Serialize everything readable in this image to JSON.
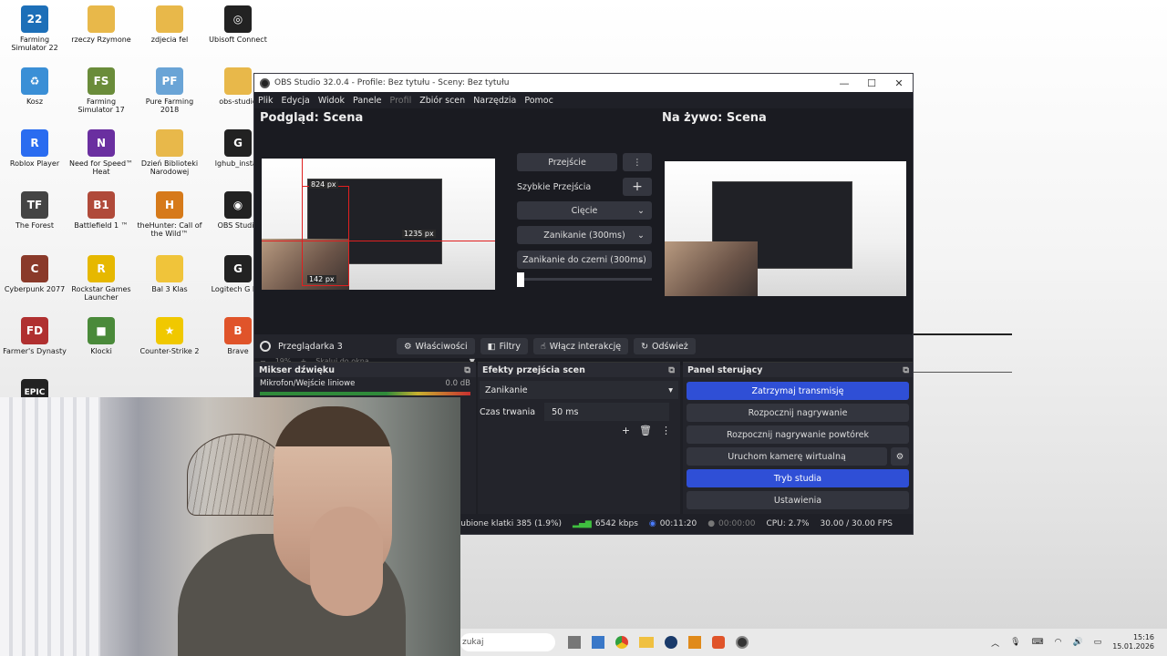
{
  "desktop": {
    "icons": [
      {
        "label": "Farming Simulator 22",
        "glyph": "22",
        "color": "#1d6fb8"
      },
      {
        "label": "rzeczy Rzymone",
        "glyph": "",
        "color": "#e8b84a"
      },
      {
        "label": "zdjecia fel",
        "glyph": "",
        "color": "#e8b84a"
      },
      {
        "label": "Ubisoft Connect",
        "glyph": "◎",
        "color": "#222"
      },
      {
        "label": "Kosz",
        "glyph": "♻",
        "color": "#3a8fd6"
      },
      {
        "label": "Farming Simulator 17",
        "glyph": "FS",
        "color": "#6a8c3a"
      },
      {
        "label": "Pure Farming 2018",
        "glyph": "PF",
        "color": "#6aa4d6"
      },
      {
        "label": "obs-studio",
        "glyph": "",
        "color": "#e8b84a"
      },
      {
        "label": "Roblox Player",
        "glyph": "R",
        "color": "#2a6cf0"
      },
      {
        "label": "Need for Speed™ Heat",
        "glyph": "N",
        "color": "#6a2fa0"
      },
      {
        "label": "Dzień Biblioteki Narodowej",
        "glyph": "",
        "color": "#e8b84a"
      },
      {
        "label": "lghub_install",
        "glyph": "G",
        "color": "#222"
      },
      {
        "label": "The Forest",
        "glyph": "TF",
        "color": "#444"
      },
      {
        "label": "Battlefield 1 ™",
        "glyph": "B1",
        "color": "#b04a3a"
      },
      {
        "label": "theHunter: Call of the Wild™",
        "glyph": "H",
        "color": "#d67a1a"
      },
      {
        "label": "OBS Studio",
        "glyph": "◉",
        "color": "#222"
      },
      {
        "label": "Cyberpunk 2077",
        "glyph": "C",
        "color": "#8a3a2a"
      },
      {
        "label": "Rockstar Games Launcher",
        "glyph": "R",
        "color": "#e6b800"
      },
      {
        "label": "Bal 3 Klas",
        "glyph": "",
        "color": "#f0c43a"
      },
      {
        "label": "Logitech G H...",
        "glyph": "G",
        "color": "#222"
      },
      {
        "label": "Farmer's Dynasty",
        "glyph": "FD",
        "color": "#b03030"
      },
      {
        "label": "Klocki",
        "glyph": "■",
        "color": "#4a8a3a"
      },
      {
        "label": "Counter-Strike 2",
        "glyph": "★",
        "color": "#f0c800"
      },
      {
        "label": "Brave",
        "glyph": "B",
        "color": "#e0542a"
      }
    ],
    "extra_glyph": "EPIC"
  },
  "obs": {
    "title": "OBS Studio 32.0.4 - Profile: Bez tytułu - Sceny: Bez tytułu",
    "window_controls": [
      "—",
      "☐",
      "✕"
    ],
    "menu": [
      {
        "label": "Plik",
        "dim": false
      },
      {
        "label": "Edycja",
        "dim": false
      },
      {
        "label": "Widok",
        "dim": false
      },
      {
        "label": "Panele",
        "dim": false
      },
      {
        "label": "Profil",
        "dim": true
      },
      {
        "label": "Zbiór scen",
        "dim": false
      },
      {
        "label": "Narzędzia",
        "dim": false
      },
      {
        "label": "Pomoc",
        "dim": false
      }
    ],
    "preview_title": "Podgląd: Scena",
    "live_title": "Na żywo: Scena",
    "overlay_labels": {
      "top": "824 px",
      "right": "1235 px",
      "bottom": "142 px"
    },
    "transition": {
      "transition_btn": "Przejście",
      "more_icon": "⋮",
      "quick_label": "Szybkie Przejścia",
      "add_icon": "+",
      "options": [
        "Cięcie",
        "Zanikanie (300ms)",
        "Zanikanie do czerni (300ms)"
      ],
      "chevron": "⌄"
    },
    "zoom": {
      "minus": "−",
      "percent": "19%",
      "plus": "+",
      "fit": "Skaluj do okna",
      "arrow": "▼"
    },
    "source_bar": {
      "source_name": "Przeglądarka 3",
      "buttons": [
        {
          "icon": "⚙",
          "label": "Właściwości"
        },
        {
          "icon": "◧",
          "label": "Filtry"
        },
        {
          "icon": "☝",
          "label": "Włącz interakcję"
        },
        {
          "icon": "↻",
          "label": "Odśwież"
        }
      ]
    },
    "mixer": {
      "title": "Mikser dźwięku",
      "track": "Mikrofon/Wejście liniowe",
      "db": "0.0 dB"
    },
    "transitions_dock": {
      "title": "Efekty przejścia scen",
      "selected": "Zanikanie",
      "duration_label": "Czas trwania",
      "duration_value": "50 ms",
      "icons": [
        "+",
        "🗑",
        "⋮"
      ]
    },
    "controls": {
      "title": "Panel sterujący",
      "buttons": [
        {
          "label": "Zatrzymaj transmisję",
          "active": true
        },
        {
          "label": "Rozpocznij nagrywanie",
          "active": false
        },
        {
          "label": "Rozpocznij nagrywanie powtórek",
          "active": false
        },
        {
          "label": "Uruchom kamerę wirtualną",
          "active": false
        },
        {
          "label": "Tryb studia",
          "active": true
        },
        {
          "label": "Ustawienia",
          "active": false
        }
      ],
      "gear": "⚙"
    },
    "status": {
      "dropped": "Zgubione klatki 385 (1.9%)",
      "bitrate": "6542 kbps",
      "live_time": "00:11:20",
      "rec_time": "00:00:00",
      "cpu": "CPU: 2.7%",
      "fps": "30.00 / 30.00 FPS"
    }
  },
  "taskbar": {
    "search_placeholder": "zukaj",
    "clock_time": "15:16",
    "clock_date": "15.01.2026"
  },
  "colors": {
    "accent": "#2f4fd6",
    "obs_bg": "#1e1f25",
    "selection": "#e02020"
  }
}
